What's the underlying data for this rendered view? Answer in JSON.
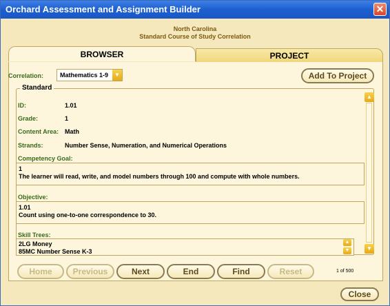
{
  "window": {
    "title": "Orchard Assessment and Assignment Builder"
  },
  "header": {
    "line1": "North Carolina",
    "line2": "Standard Course of Study Correlation"
  },
  "tabs": [
    {
      "label": "BROWSER"
    },
    {
      "label": "PROJECT"
    }
  ],
  "correlation": {
    "label": "Correlation:",
    "value": "Mathematics 1-9"
  },
  "add_to_project": "Add To Project",
  "standard": {
    "legend": "Standard",
    "id_label": "ID:",
    "id": "1.01",
    "grade_label": "Grade:",
    "grade": "1",
    "content_area_label": "Content Area:",
    "content_area": "Math",
    "strands_label": "Strands:",
    "strands": "Number Sense, Numeration, and Numerical Operations",
    "competency_goal_label": "Competency Goal:",
    "competency_goal_number": "1",
    "competency_goal_text": "The learner will read, write, and model numbers through 100 and compute with whole numbers.",
    "objective_label": "Objective:",
    "objective_number": "1.01",
    "objective_text": "Count using one-to-one correspondence to 30.",
    "skill_trees_label": "Skill Trees:",
    "skill_trees": [
      "2LG  Money",
      "85MC  Number Sense K-3"
    ]
  },
  "nav": {
    "home": "Home",
    "previous": "Previous",
    "next": "Next",
    "end": "End",
    "find": "Find",
    "reset": "Reset"
  },
  "page_count": "1 of 500",
  "close": "Close",
  "colors": {
    "titlebar": "#1d5fd0",
    "background": "#f6e8bd",
    "label": "#3a6a1a"
  }
}
